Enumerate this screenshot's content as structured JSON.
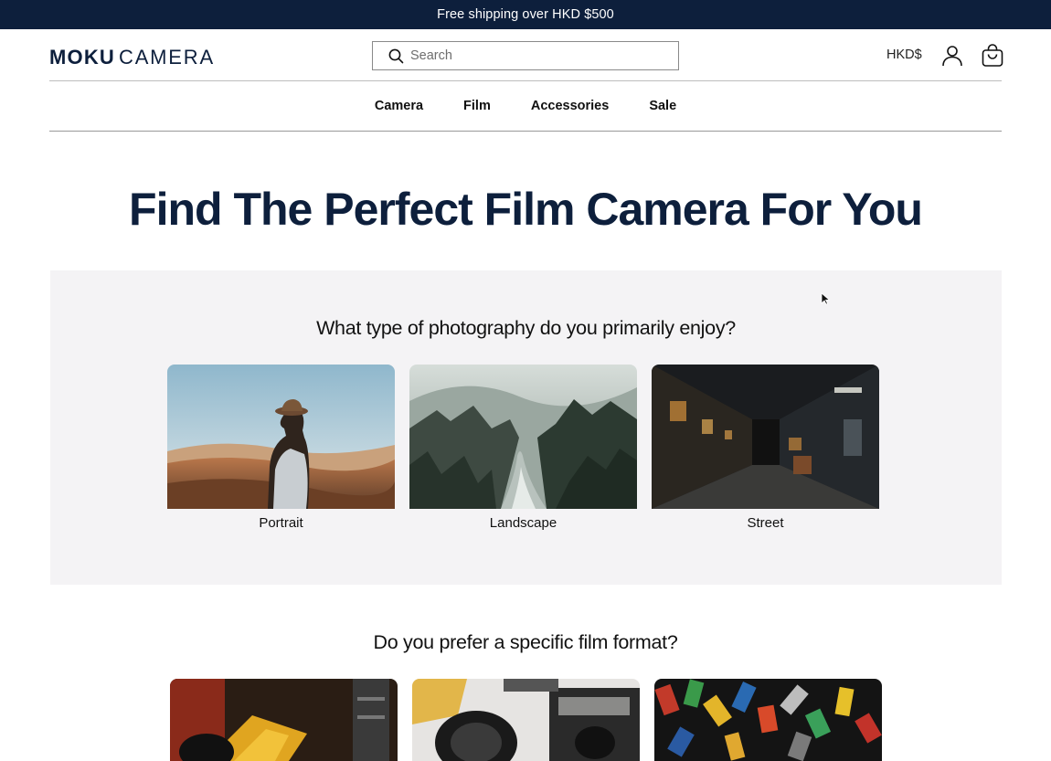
{
  "announcement": "Free shipping over HKD $500",
  "brand": {
    "bold": "MOKU",
    "light": "CAMERA"
  },
  "search": {
    "placeholder": "Search"
  },
  "header": {
    "currency": "HKD$",
    "account_icon": "account-icon",
    "cart_icon": "cart-icon"
  },
  "nav": {
    "items": [
      {
        "label": "Camera"
      },
      {
        "label": "Film"
      },
      {
        "label": "Accessories"
      },
      {
        "label": "Sale"
      }
    ]
  },
  "hero": {
    "title": "Find The Perfect Film Camera For You"
  },
  "quiz": {
    "question1": "What type of photography do you primarily enjoy?",
    "options1": [
      {
        "label": "Portrait"
      },
      {
        "label": "Landscape"
      },
      {
        "label": "Street"
      }
    ],
    "question2": "Do you prefer a specific film format?"
  },
  "colors": {
    "navy": "#0d1f3c",
    "panel": "#f4f3f5"
  }
}
